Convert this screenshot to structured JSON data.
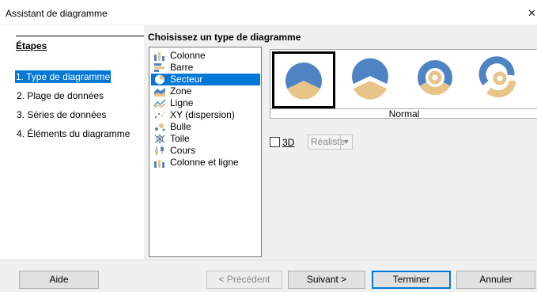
{
  "window": {
    "title": "Assistant de diagramme",
    "close_glyph": "✕"
  },
  "steps": {
    "heading": "Étapes",
    "items": [
      {
        "label": "1. Type de diagramme",
        "active": true
      },
      {
        "label": "2. Plage de données",
        "active": false
      },
      {
        "label": "3. Séries de données",
        "active": false
      },
      {
        "label": "4. Éléments du diagramme",
        "active": false
      }
    ]
  },
  "main": {
    "heading": "Choisissez un type de diagramme",
    "chart_types": [
      {
        "label": "Colonne",
        "icon": "column-chart-icon"
      },
      {
        "label": "Barre",
        "icon": "bar-chart-icon"
      },
      {
        "label": "Secteur",
        "icon": "pie-chart-icon",
        "selected": true
      },
      {
        "label": "Zone",
        "icon": "area-chart-icon"
      },
      {
        "label": "Ligne",
        "icon": "line-chart-icon"
      },
      {
        "label": "XY (dispersion)",
        "icon": "scatter-chart-icon"
      },
      {
        "label": "Bulle",
        "icon": "bubble-chart-icon"
      },
      {
        "label": "Toile",
        "icon": "net-chart-icon"
      },
      {
        "label": "Cours",
        "icon": "stock-chart-icon"
      },
      {
        "label": "Colonne et ligne",
        "icon": "column-line-chart-icon"
      }
    ],
    "variant_label": "Normal",
    "variants": [
      "pie-normal-icon",
      "pie-exploded-icon",
      "donut-icon",
      "donut-exploded-icon"
    ],
    "option_3d": {
      "label": "3D",
      "checked": false
    },
    "style_select": {
      "value": "Réaliste"
    }
  },
  "footer": {
    "help": "Aide",
    "previous": "< Précédent",
    "next": "Suivant >",
    "finish": "Terminer",
    "cancel": "Annuler"
  },
  "colors": {
    "accent": "#0078d7",
    "pie_blue": "#4e84c4",
    "pie_tan": "#e9c489"
  }
}
